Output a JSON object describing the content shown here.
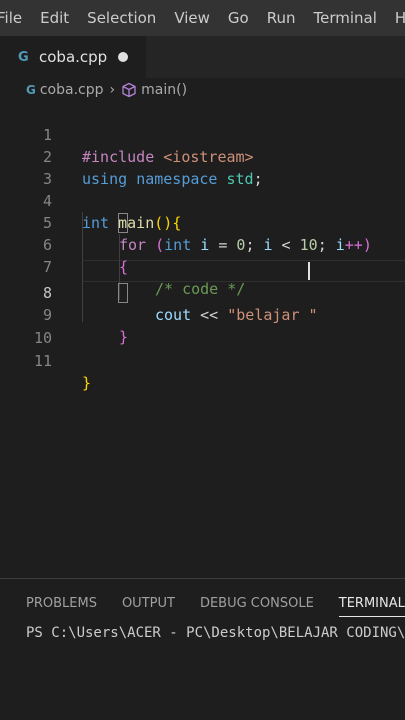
{
  "menu": [
    "File",
    "Edit",
    "Selection",
    "View",
    "Go",
    "Run",
    "Terminal",
    "Help"
  ],
  "tab": {
    "icon": "cpp-file-icon",
    "icon_glyph": "G",
    "label": "coba.cpp"
  },
  "breadcrumb": {
    "file": "coba.cpp",
    "symbol": "main()"
  },
  "editor": {
    "line_numbers": [
      "1",
      "2",
      "3",
      "4",
      "5",
      "6",
      "7",
      "8",
      "9",
      "10",
      "11"
    ],
    "line1": {
      "directive": "#include",
      "header": "<iostream>"
    },
    "line2": {
      "kw1": "using",
      "kw2": "namespace",
      "ns": "std",
      "semi": ";"
    },
    "line4": {
      "kw": "int",
      "fn": "main",
      "parens": "()",
      "brace": "{"
    },
    "line5": {
      "ctrl": "for",
      "open": " (",
      "type": "int",
      "var1": "i",
      "eq": " = ",
      "n0": "0",
      "semi1": "; ",
      "var2": "i",
      "lt": " < ",
      "n10": "10",
      "semi2": "; ",
      "var3": "i",
      "inc": "++)"
    },
    "line6": {
      "brace": "{"
    },
    "line7": {
      "comment": "/* code */"
    },
    "line8": {
      "var": "cout",
      "op": " << ",
      "str_open": "\"belajar ",
      "str_close": "\""
    },
    "line9": {
      "brace": "}"
    },
    "line11": {
      "brace": "}"
    }
  },
  "panel": {
    "tabs": [
      "PROBLEMS",
      "OUTPUT",
      "DEBUG CONSOLE",
      "TERMINAL"
    ],
    "active_tab": "TERMINAL",
    "terminal_text": "PS C:\\Users\\ACER - PC\\Desktop\\BELAJAR CODING\\C"
  },
  "colors": {
    "bg": "#1e1e1e",
    "menubar": "#333333",
    "keyword": "#569cd6",
    "string": "#ce9178",
    "comment": "#6a9955"
  }
}
